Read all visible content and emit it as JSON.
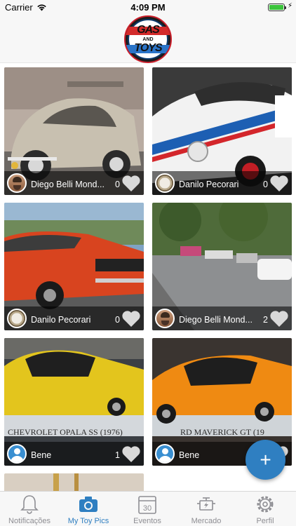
{
  "status_bar": {
    "carrier": "Carrier",
    "time": "4:09 PM"
  },
  "header": {
    "logo_top": "GAS",
    "logo_mid": "AND",
    "logo_bottom": "TOYS"
  },
  "cards": [
    {
      "owner": "Diego Belli Mond...",
      "likes": "0",
      "avatar": "face"
    },
    {
      "owner": "Danilo Pecorari",
      "likes": "0",
      "avatar": "watch"
    },
    {
      "owner": "Danilo Pecorari",
      "likes": "0",
      "avatar": "watch"
    },
    {
      "owner": "Diego Belli Mond...",
      "likes": "2",
      "avatar": "face"
    },
    {
      "owner": "Bene",
      "likes": "1",
      "avatar": "user"
    },
    {
      "owner": "Bene",
      "likes": "",
      "avatar": "user"
    }
  ],
  "fab": {
    "label": "+"
  },
  "tabbar": {
    "tabs": [
      {
        "label": "Notificações",
        "icon": "bell-icon"
      },
      {
        "label": "My Toy Pics",
        "icon": "camera-icon",
        "active": true
      },
      {
        "label": "Eventos",
        "icon": "calendar-icon",
        "day": "30"
      },
      {
        "label": "Mercado",
        "icon": "engine-icon"
      },
      {
        "label": "Perfil",
        "icon": "gear-icon"
      }
    ]
  },
  "colors": {
    "accent": "#2f7fc1",
    "inactive": "#8e8e93",
    "bar_bg": "#f7f7f7"
  }
}
